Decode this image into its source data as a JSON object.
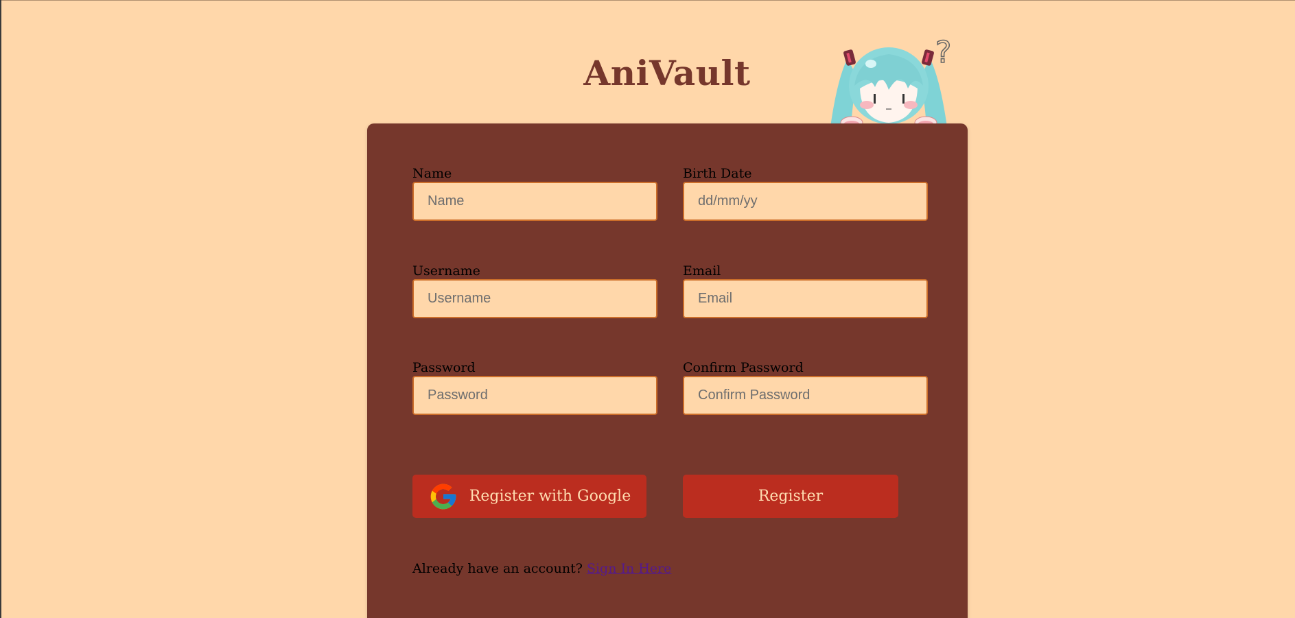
{
  "app": {
    "title": "AniVault"
  },
  "form": {
    "fields": [
      {
        "label": "Name",
        "placeholder": "Name",
        "value": ""
      },
      {
        "label": "Birth Date",
        "placeholder": "dd/mm/yy",
        "value": ""
      },
      {
        "label": "Username",
        "placeholder": "Username",
        "value": ""
      },
      {
        "label": "Email",
        "placeholder": "Email",
        "value": ""
      },
      {
        "label": "Password",
        "placeholder": "Password",
        "value": ""
      },
      {
        "label": "Confirm Password",
        "placeholder": "Confirm Password",
        "value": ""
      }
    ],
    "google_button_label": "Register with Google",
    "register_button_label": "Register",
    "signin_prompt": "Already have an account?",
    "signin_link_label": "Sign In Here"
  },
  "mascot": {
    "question_mark": "?"
  },
  "icons": {
    "google": "google-icon",
    "mascot": "mascot-icon"
  },
  "colors": {
    "page_background": "#ffd7aa",
    "card_background": "#76372c",
    "brand_text": "#76372c",
    "input_border": "#cc6e2a",
    "button_background": "#bb2d1f",
    "button_text": "#ffdcb0",
    "link": "#551a8b"
  }
}
